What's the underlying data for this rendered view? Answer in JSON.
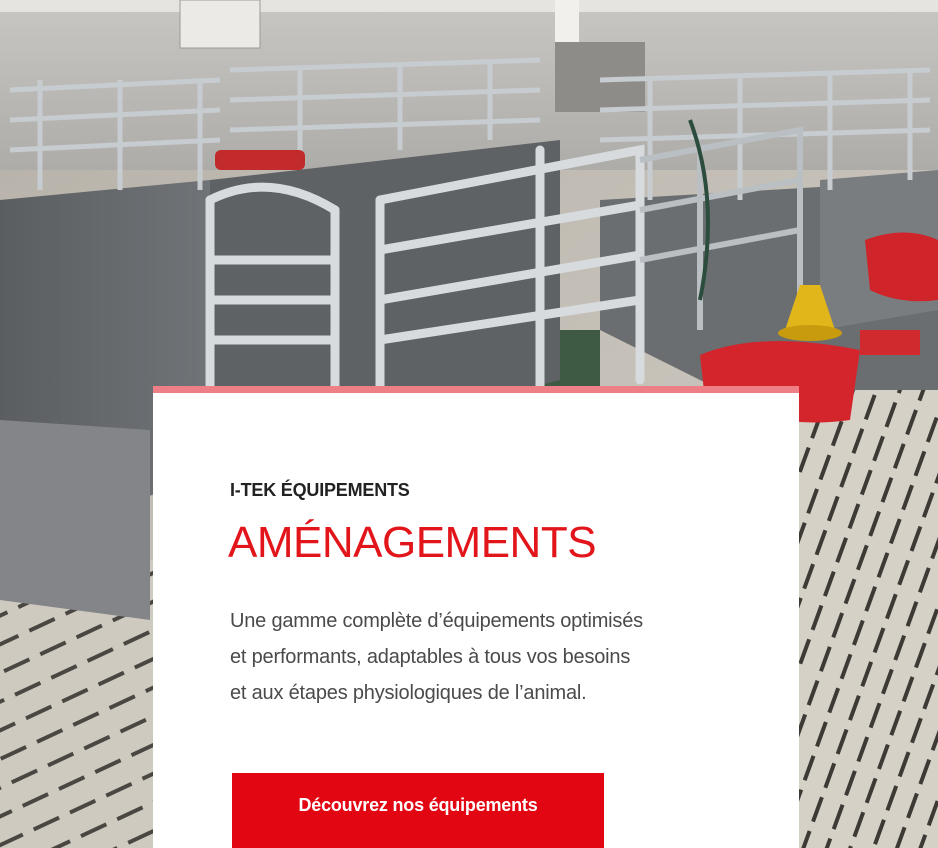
{
  "card": {
    "eyebrow": "I-TEK ÉQUIPEMENTS",
    "title": "AMÉNAGEMENTS",
    "description_lines": [
      "Une gamme complète d’équipements optimisés",
      "et performants, adaptables à tous vos besoins",
      "et aux étapes physiologiques de l’animal."
    ],
    "cta_label": "Découvrez nos équipements"
  },
  "colors": {
    "accent": "#e20613",
    "title_red": "#e2151b",
    "card_top_border": "#ee7f86",
    "eyebrow_text": "#222222",
    "body_text": "#4a4a4a"
  },
  "icons": {
    "hero_image": "livestock-pen-photo"
  }
}
